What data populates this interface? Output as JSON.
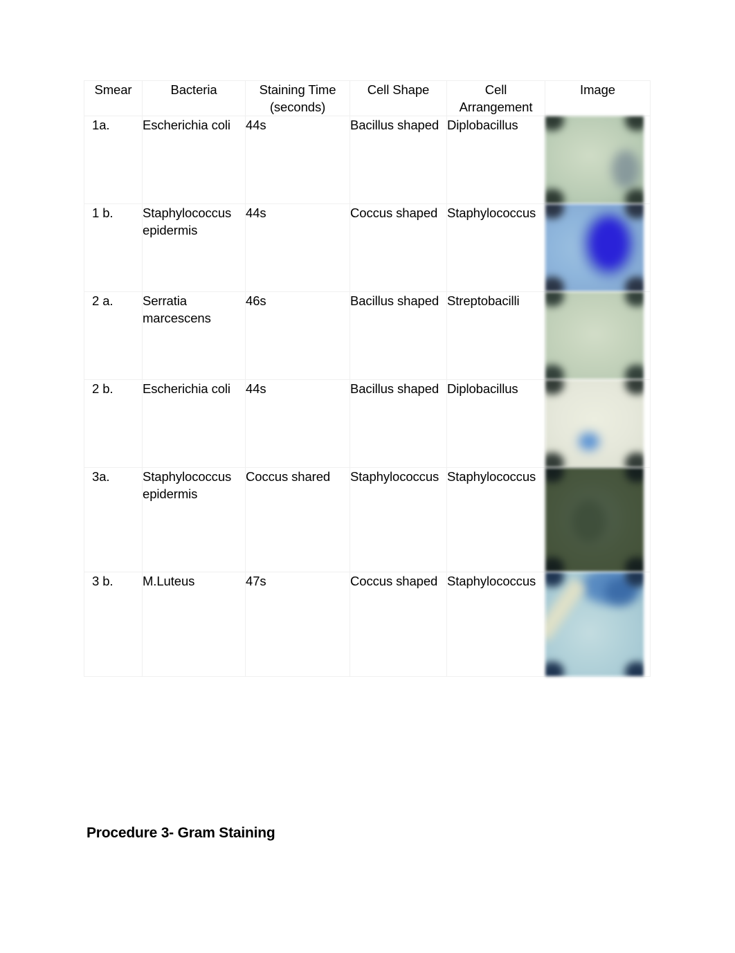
{
  "document": {
    "background_color": "#ffffff",
    "text_color": "#000000",
    "border_color": "#f0f0f0"
  },
  "table": {
    "name": "gram-staining-results-table",
    "headers": [
      "Smear",
      "Bacteria",
      "Staining Time (seconds)",
      "Cell Shape",
      "Cell Arrangement",
      "Image"
    ],
    "header_lines": {
      "smear": "Smear",
      "bacteria": "Bacteria",
      "staining_time_l1": "Staining Time",
      "staining_time_l2": "(seconds)",
      "cell_shape": "Cell Shape",
      "cell_arrangement_l1": "Cell",
      "cell_arrangement_l2": "Arrangement",
      "image": "Image"
    },
    "rows": [
      {
        "smear": "1a.",
        "bacteria": "Escherichia coli",
        "staining_time": "44s",
        "cell_shape": "Bacillus shaped",
        "cell_arrangement": "Diplobacillus",
        "image_alt": "micrograph-sage-green-field",
        "image_colors": {
          "field": "#c2d2bb",
          "corners": "#2e3b33",
          "accent": "#5d6f86"
        }
      },
      {
        "smear": "1 b.",
        "bacteria": "Staphylococcus epidermis",
        "staining_time": "44s",
        "cell_shape": "Coccus shaped",
        "cell_arrangement": "Staphylococcus",
        "image_alt": "micrograph-light-blue-with-indigo-blob",
        "image_colors": {
          "field": "#8fb6dc",
          "corners": "#2b3546",
          "accent": "#2a22d8"
        }
      },
      {
        "smear": "2 a.",
        "bacteria": "Serratia marcescens",
        "staining_time": "46s",
        "cell_shape": "Bacillus shaped",
        "cell_arrangement": "Streptobacilli",
        "image_alt": "micrograph-pale-sage-green-field",
        "image_colors": {
          "field": "#c6d4bd",
          "corners": "#33413a",
          "accent": "#c6d4bd"
        }
      },
      {
        "smear": "2 b.",
        "bacteria": "Escherichia coli",
        "staining_time": "44s",
        "cell_shape": "Bacillus shaped",
        "cell_arrangement": "Diplobacillus",
        "image_alt": "micrograph-cream-field-with-blue-dot",
        "image_colors": {
          "field": "#e6e8db",
          "corners": "#333c37",
          "accent": "#5b93d4"
        }
      },
      {
        "smear": "3a.",
        "bacteria": "Staphylococcus epidermis",
        "staining_time": "Coccus shared",
        "cell_shape": "Staphylococcus",
        "cell_arrangement": "Staphylococcus",
        "image_alt": "micrograph-dark-forest-green-field",
        "image_colors": {
          "field": "#48573f",
          "corners": "#16201f",
          "accent": "#3a4a36"
        }
      },
      {
        "smear": "3 b.",
        "bacteria": "M.Luteus",
        "staining_time": "47s",
        "cell_shape": "Coccus shaped",
        "cell_arrangement": "Staphylococcus",
        "image_alt": "micrograph-pale-blue-with-cream-streak",
        "image_colors": {
          "field": "#b4d3da",
          "corners": "#1f3552",
          "accent": "#4a7fbe"
        }
      }
    ]
  },
  "heading": {
    "text": "Procedure 3- Gram Staining"
  }
}
